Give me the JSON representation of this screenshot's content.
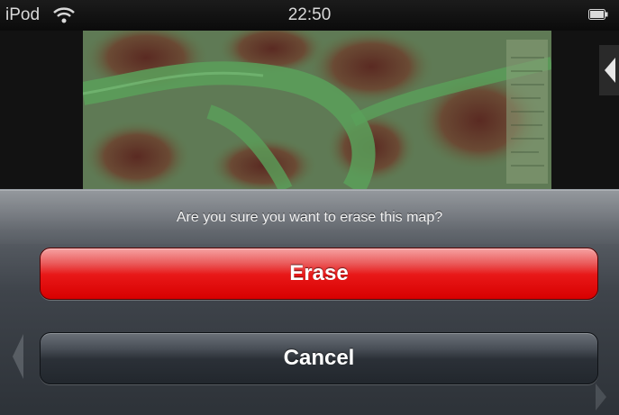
{
  "status_bar": {
    "carrier": "iPod",
    "time": "22:50",
    "wifi_icon": "wifi-icon",
    "battery_icon": "battery-icon"
  },
  "map": {
    "image": "topographic-map",
    "side_control_icon": "chevron-left-icon"
  },
  "action_sheet": {
    "message": "Are you sure you want to erase this map?",
    "erase_label": "Erase",
    "cancel_label": "Cancel",
    "erase_color": "#e00000",
    "cancel_color": "#2b3037"
  }
}
